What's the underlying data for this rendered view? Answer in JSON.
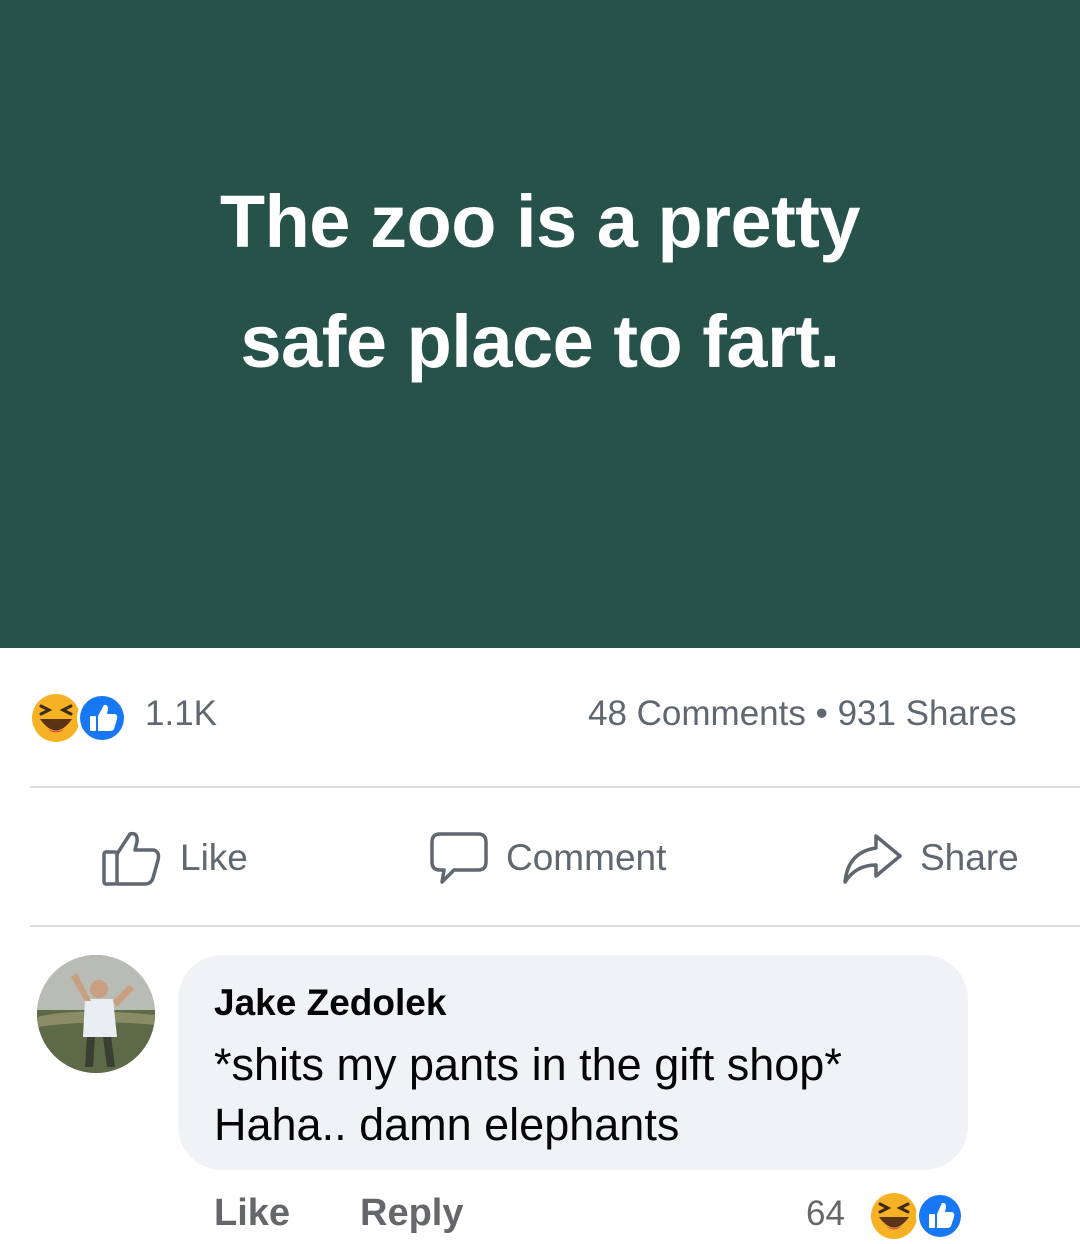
{
  "post": {
    "text_lines": [
      "The zoo is a pretty",
      "safe place to fart."
    ],
    "background_color": "#26524a"
  },
  "reactions": {
    "icons": [
      "haha-reaction-icon",
      "like-reaction-icon"
    ],
    "count": "1.1K",
    "stats": "48 Comments • 931 Shares"
  },
  "actions": {
    "like_label": "Like",
    "comment_label": "Comment",
    "share_label": "Share"
  },
  "comment": {
    "author": "Jake Zedolek",
    "text_lines": [
      "*shits my pants in the gift shop*",
      "Haha.. damn elephants"
    ],
    "like_label": "Like",
    "reply_label": "Reply",
    "reaction_count": "64",
    "reaction_icons": [
      "haha-reaction-icon",
      "like-reaction-icon"
    ]
  },
  "colors": {
    "like_blue": "#1877f2",
    "haha_yellow": "#f7b125",
    "muted_text": "#606770"
  }
}
